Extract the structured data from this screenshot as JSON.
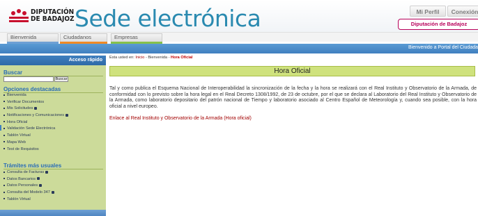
{
  "header": {
    "org_line1": "DIPUTACIÓN",
    "org_line2": "DE BADAJOZ",
    "site_title": "Sede electrónica",
    "perfil_label": "Mi Perfil",
    "conexion_label": "Conexión",
    "diputacion_selector": "Diputación de Badajoz"
  },
  "tabs": [
    {
      "label": "Bienvenida",
      "accent": "#6ea0d4"
    },
    {
      "label": "Ciudadanos",
      "accent": "#f08a24"
    },
    {
      "label": "Empresas",
      "accent": "#86c14a"
    }
  ],
  "topbar": {
    "welcome": "Bienvenido a Portal del Ciudada"
  },
  "sidebar": {
    "quick_access": "Acceso rápido",
    "search_heading": "Buscar",
    "search_value": "",
    "search_button": "Buscar",
    "featured_heading": "Opciones destacadas",
    "featured_items": [
      {
        "label": "Bienvenida",
        "locked": false
      },
      {
        "label": "Verificar Documentos",
        "locked": false
      },
      {
        "label": "Mis Solicitudes",
        "locked": true
      },
      {
        "label": "Notificaciones y Comunicaciones",
        "locked": true
      },
      {
        "label": "Hora Oficial",
        "locked": false
      },
      {
        "label": "Validación Sede Electrónica",
        "locked": false
      },
      {
        "label": "Tablón Virtual",
        "locked": false
      },
      {
        "label": "Mapa Web",
        "locked": false
      },
      {
        "label": "Test de Requisitos",
        "locked": false
      }
    ],
    "frequent_heading": "Trámites más usuales",
    "frequent_items": [
      {
        "label": "Consulta de Facturas",
        "locked": true
      },
      {
        "label": "Datos Bancarios",
        "locked": true
      },
      {
        "label": "Datos Personales",
        "locked": true
      },
      {
        "label": "Consulta del Modelo 347",
        "locked": true
      },
      {
        "label": "Tablón Virtual",
        "locked": false
      }
    ]
  },
  "breadcrumb": {
    "prefix": "Esta usted en:",
    "home": "Inicio",
    "section": "Bienvenida",
    "current": "Hora Oficial",
    "separator": " - "
  },
  "main": {
    "title": "Hora Oficial",
    "paragraph": "Tal y como publica el Esquema Nacional de Interoperabilidad la sincronización de la fecha y la hora se realizará con el Real Instituto y Observatorio de la Armada, de conformidad con lo previsto sobre la hora legal en el Real Decreto 1308/1992, de 23 de octubre, por el que se declara al Laboratorio del Real Instituto y Observatorio de la Armada, como laboratorio depositario del patrón nacional de Tiempo y laboratorio asociado al Centro Español de Meteorología y, cuando sea posible, con la hora oficial a nivel europeo.",
    "link": "Enlace al Real Instituto y Observatorio de la Armada (Hora oficial)"
  },
  "colors": {
    "brand_blue": "#2a8ab0",
    "brand_magenta": "#b8005a",
    "sidebar_bg": "#ccdb9a",
    "title_bar": "#cfe27d",
    "link_red": "#a20000"
  }
}
